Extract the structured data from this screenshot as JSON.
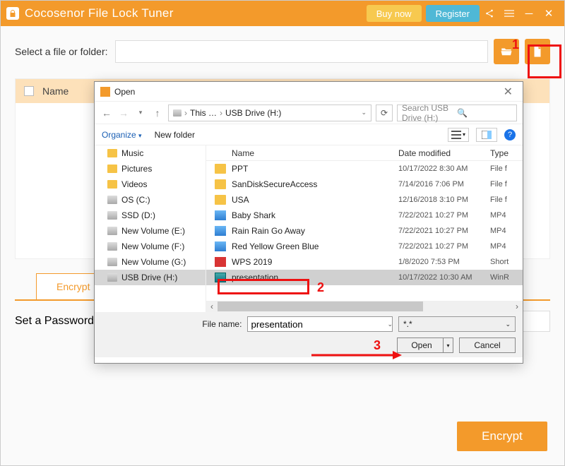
{
  "app": {
    "title": "Cocosenor File Lock Tuner",
    "buy_label": "Buy now",
    "register_label": "Register"
  },
  "main": {
    "select_label": "Select a file or folder:",
    "name_header": "Name",
    "tab_encrypt": "Encrypt",
    "password_label": "Set a Password:",
    "encrypt_button": "Encrypt"
  },
  "dialog": {
    "title": "Open",
    "breadcrumb": {
      "root": "This …",
      "leaf": "USB Drive (H:)"
    },
    "search_placeholder": "Search USB Drive (H:)",
    "organize": "Organize",
    "new_folder": "New folder",
    "help": "?",
    "columns": {
      "name": "Name",
      "date": "Date modified",
      "type": "Type"
    },
    "tree": [
      {
        "label": "Music",
        "icon": "music"
      },
      {
        "label": "Pictures",
        "icon": "pictures"
      },
      {
        "label": "Videos",
        "icon": "videos"
      },
      {
        "label": "OS (C:)",
        "icon": "drive"
      },
      {
        "label": "SSD (D:)",
        "icon": "drive"
      },
      {
        "label": "New Volume (E:)",
        "icon": "drive"
      },
      {
        "label": "New Volume (F:)",
        "icon": "drive"
      },
      {
        "label": "New Volume (G:)",
        "icon": "drive"
      },
      {
        "label": "USB Drive (H:)",
        "icon": "drive",
        "selected": true
      }
    ],
    "files": [
      {
        "name": "PPT",
        "date": "10/17/2022 8:30 AM",
        "type": "File f",
        "icon": "folder"
      },
      {
        "name": "SanDiskSecureAccess",
        "date": "7/14/2016 7:06 PM",
        "type": "File f",
        "icon": "folder"
      },
      {
        "name": "USA",
        "date": "12/16/2018 3:10 PM",
        "type": "File f",
        "icon": "folder"
      },
      {
        "name": "Baby Shark",
        "date": "7/22/2021 10:27 PM",
        "type": "MP4",
        "icon": "mp4"
      },
      {
        "name": "Rain Rain Go Away",
        "date": "7/22/2021 10:27 PM",
        "type": "MP4",
        "icon": "mp4"
      },
      {
        "name": "Red Yellow Green Blue",
        "date": "7/22/2021 10:27 PM",
        "type": "MP4",
        "icon": "mp4"
      },
      {
        "name": "WPS 2019",
        "date": "1/8/2020 7:53 PM",
        "type": "Short",
        "icon": "wps"
      },
      {
        "name": "presentation",
        "date": "10/17/2022 10:30 AM",
        "type": "WinR",
        "icon": "rar",
        "selected": true
      }
    ],
    "filename_label": "File name:",
    "filename_value": "presentation",
    "filter": "*.*",
    "open_label": "Open",
    "cancel_label": "Cancel"
  },
  "annotations": {
    "n1": "1",
    "n2": "2",
    "n3": "3"
  }
}
